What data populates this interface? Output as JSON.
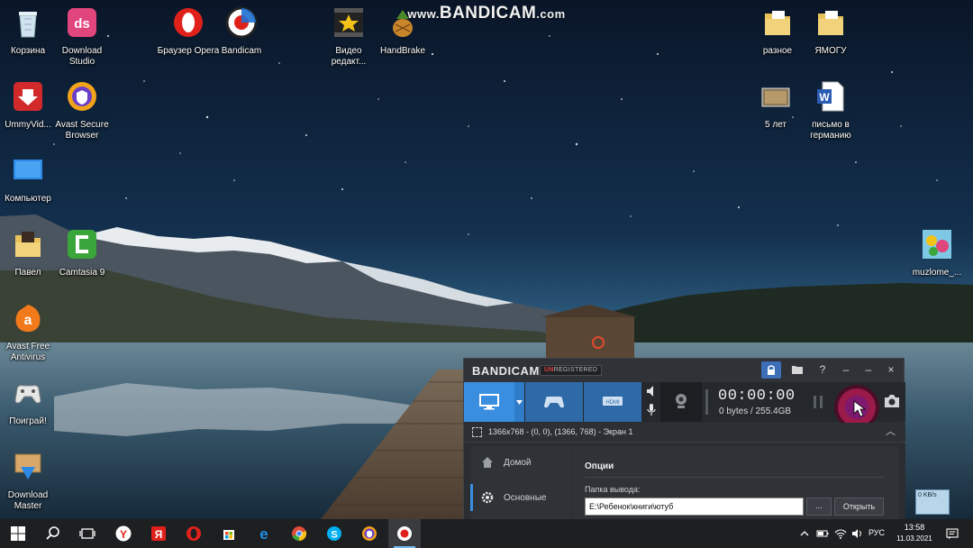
{
  "watermark": {
    "www": "www.",
    "brand": "BANDICAM",
    "tld": ".com"
  },
  "desktop_icons": [
    {
      "label": "Корзина"
    },
    {
      "label": "Download Studio"
    },
    {
      "label": "Браузер Opera"
    },
    {
      "label": "Bandicam"
    },
    {
      "label": "Видео редакт..."
    },
    {
      "label": "HandBrake"
    },
    {
      "label": "разное"
    },
    {
      "label": "ЯМОГУ"
    },
    {
      "label": "UmmyVid..."
    },
    {
      "label": "Avast Secure Browser"
    },
    {
      "label": "5 лет"
    },
    {
      "label": "письмо в германию"
    },
    {
      "label": "Компьютер"
    },
    {
      "label": "Павел"
    },
    {
      "label": "Camtasia 9"
    },
    {
      "label": "muzlome_..."
    },
    {
      "label": "Avast Free Antivirus"
    },
    {
      "label": "Поиграй!"
    },
    {
      "label": "Download Master"
    }
  ],
  "bandicam": {
    "logo": "BANDICAM",
    "badge_prefix": "UN",
    "badge_rest": "REGISTERED",
    "timer": "00:00:00",
    "size_info": "0 bytes / 255.4GB",
    "area_label": "1366x768 - (0, 0), (1366, 768) - Экран 1",
    "sidebar": {
      "home": "Домой",
      "basic": "Основные"
    },
    "options_title": "Опции",
    "output_folder_label": "Папка вывода:",
    "output_folder_value": "E:\\Ребенок\\книги\\ютуб",
    "browse_label": "...",
    "open_label": "Открыть",
    "help_glyph": "?",
    "minimize_glyph": "–",
    "restore_glyph": "–",
    "close_glyph": "×",
    "colors": {
      "accent": "#3a8ee0",
      "record": "#9a1a4a",
      "window_bg": "#2a2d31"
    }
  },
  "net_widget": {
    "text": "0 KB/s"
  },
  "taskbar": {
    "lang": "РУС",
    "time": "13:58",
    "date": "11.03.2021",
    "apps": [
      "windows-start",
      "search",
      "task-view",
      "yandex",
      "yandex-browser",
      "opera",
      "store",
      "edge",
      "chrome",
      "skype",
      "avast-browser",
      "bandicam"
    ]
  }
}
